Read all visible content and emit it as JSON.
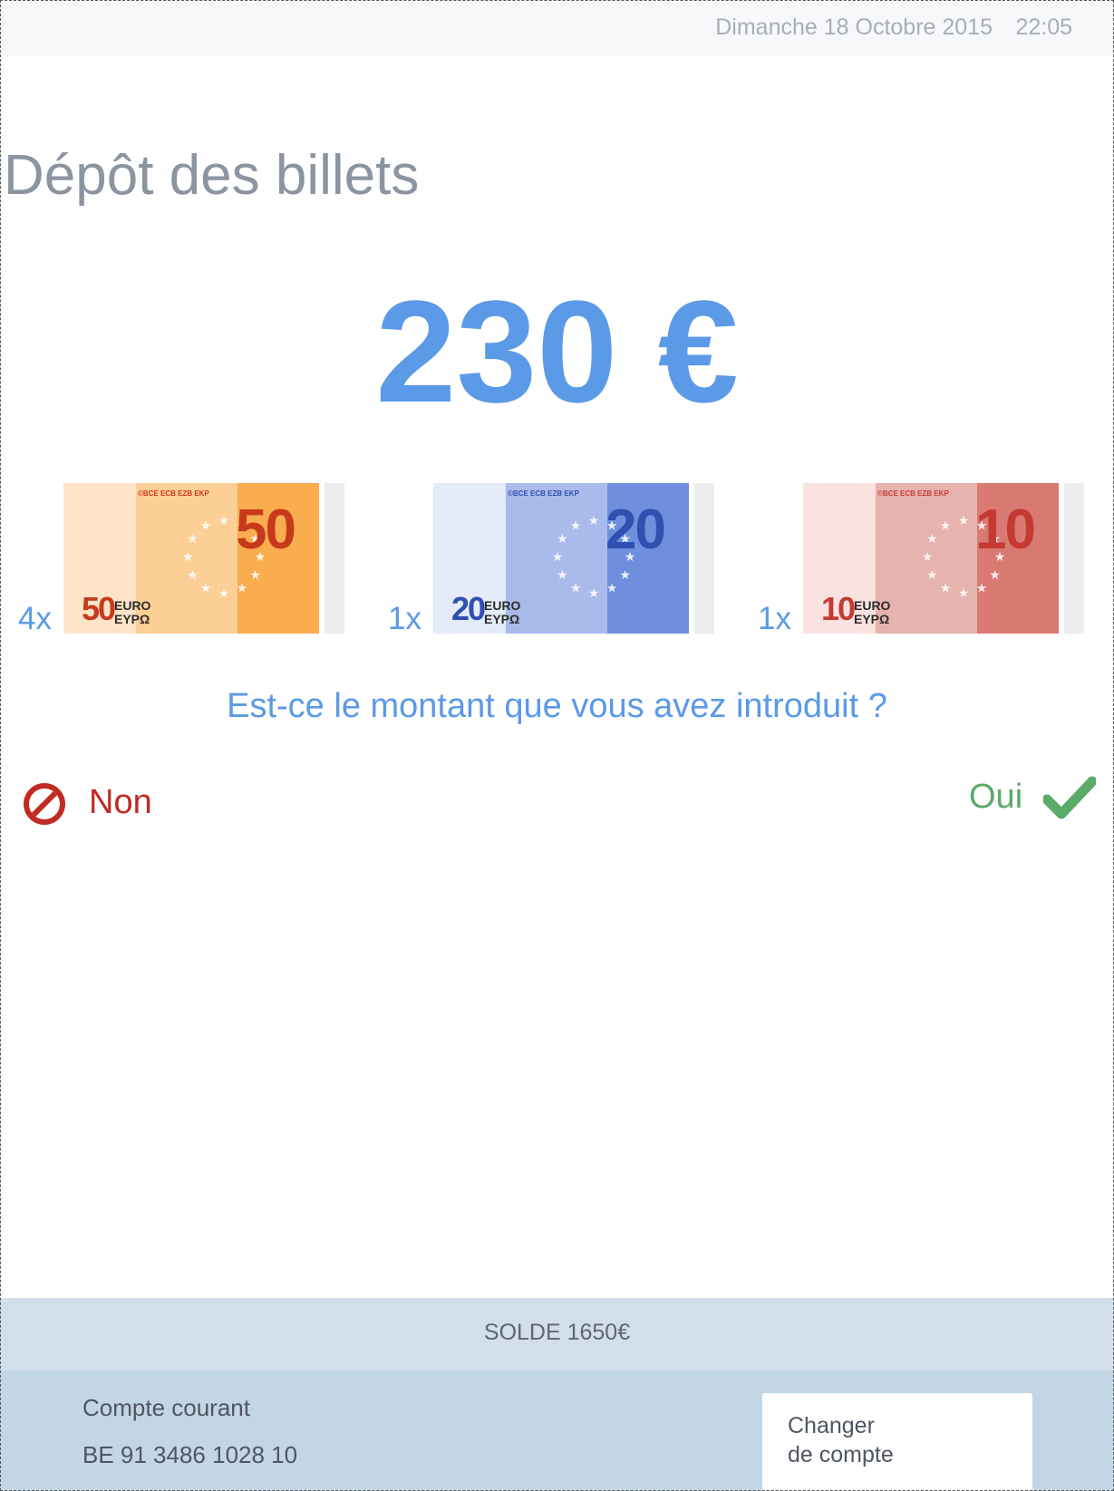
{
  "header": {
    "date": "Dimanche 18 Octobre 2015",
    "time": "22:05"
  },
  "page_title": "Dépôt des billets",
  "deposit": {
    "amount": "230 €"
  },
  "notes": [
    {
      "count": "4x",
      "value": "50",
      "euro_line1": "EURO",
      "euro_line2": "ΕΥΡΩ",
      "ecb_text": "©BCE ECB EZB EKP",
      "colors": {
        "light": "#fde4c8",
        "mid": "#fccf96",
        "dark": "#f9ad4e",
        "text": "#c8391c"
      }
    },
    {
      "count": "1x",
      "value": "20",
      "euro_line1": "EURO",
      "euro_line2": "ΕΥΡΩ",
      "ecb_text": "©BCE ECB EZB EKP",
      "colors": {
        "light": "#e4ebf9",
        "mid": "#a9bbeb",
        "dark": "#6f8fde",
        "text": "#2f4fb1"
      }
    },
    {
      "count": "1x",
      "value": "10",
      "euro_line1": "EURO",
      "euro_line2": "ΕΥΡΩ",
      "ecb_text": "©BCE ECB EZB EKP",
      "colors": {
        "light": "#f9e2e0",
        "mid": "#e7b3ae",
        "dark": "#d97a72",
        "text": "#c53a33"
      }
    }
  ],
  "question": "Est-ce le montant que vous avez introduit ?",
  "actions": {
    "no": {
      "label": "Non",
      "icon": "prohibited-icon",
      "color": "#c02b23"
    },
    "yes": {
      "label": "Oui",
      "icon": "checkmark-icon",
      "color": "#5aaa6a"
    }
  },
  "balance": {
    "text": "SOLDE 1650€"
  },
  "account": {
    "name": "Compte courant",
    "iban": "BE 91 3486 1028 10",
    "change_line1": "Changer",
    "change_line2": "de compte"
  }
}
